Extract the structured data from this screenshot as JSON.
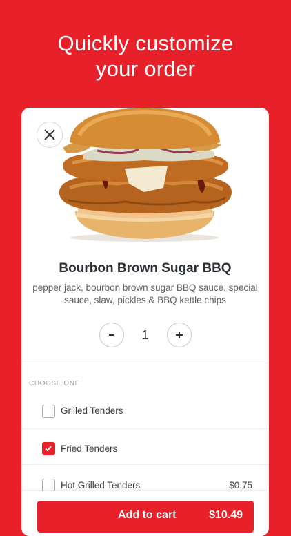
{
  "headline": {
    "line1": "Quickly customize",
    "line2": "your order"
  },
  "item": {
    "name": "Bourbon Brown Sugar BBQ",
    "description": "pepper jack, bourbon brown sugar BBQ sauce, special sauce, slaw, pickles & BBQ kettle chips"
  },
  "quantity": {
    "minus": "−",
    "value": "1",
    "plus": "+"
  },
  "options": {
    "section_label": "CHOOSE ONE",
    "items": [
      {
        "label": "Grilled Tenders",
        "price": "",
        "checked": false
      },
      {
        "label": "Fried Tenders",
        "price": "",
        "checked": true
      },
      {
        "label": "Hot Grilled Tenders",
        "price": "$0.75",
        "checked": false
      }
    ]
  },
  "cart": {
    "label": "Add to cart",
    "total": "$10.49"
  },
  "icons": {
    "close": "close-icon",
    "check": "check-icon",
    "minus": "minus-icon",
    "plus": "plus-icon"
  },
  "colors": {
    "brand_red": "#e8202a",
    "text_dark": "#2b2f33",
    "text_muted": "#5d6166"
  }
}
